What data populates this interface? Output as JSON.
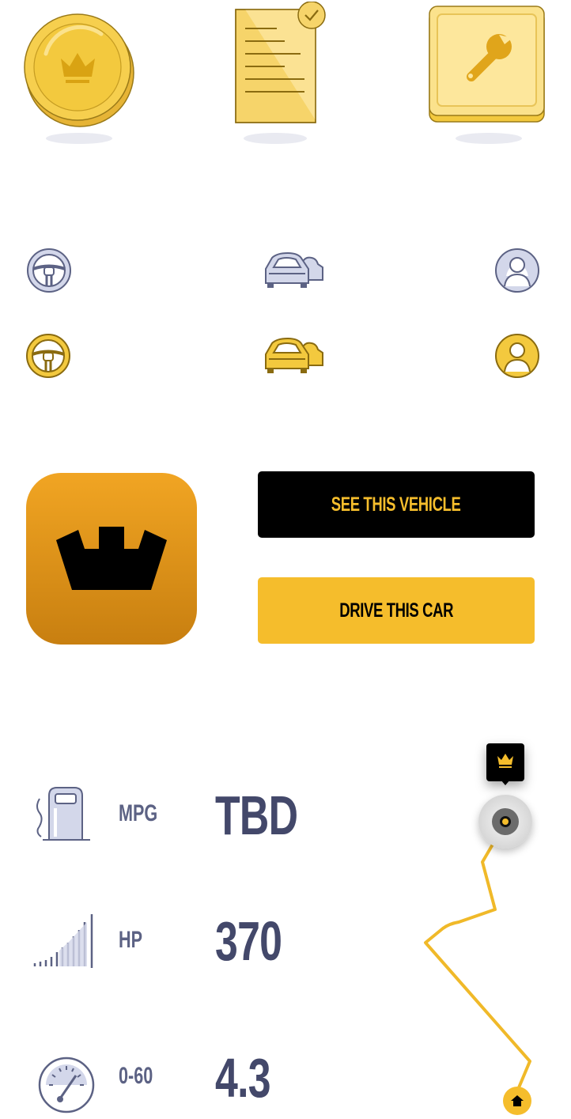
{
  "illustrations": [
    {
      "name": "coin-crown-icon"
    },
    {
      "name": "document-check-icon"
    },
    {
      "name": "wrench-box-icon"
    }
  ],
  "icon_rows": {
    "outline": [
      "steering-wheel-icon",
      "cars-icon",
      "user-icon"
    ],
    "filled": [
      "steering-wheel-icon",
      "cars-icon",
      "user-icon"
    ]
  },
  "buttons": {
    "see_vehicle": "SEE THIS VEHICLE",
    "drive_car": "DRIVE THIS CAR"
  },
  "stats": [
    {
      "icon": "fuel-pump-icon",
      "label": "MPG",
      "value": "TBD"
    },
    {
      "icon": "signal-bars-icon",
      "label": "HP",
      "value": "370"
    },
    {
      "icon": "speedometer-icon",
      "label": "0-60",
      "value": "4.3"
    }
  ],
  "colors": {
    "accent": "#f5bd2c",
    "dark": "#000000",
    "slate": "#5c6284",
    "app_icon_top": "#f1a523",
    "app_icon_bottom": "#c87f10"
  }
}
